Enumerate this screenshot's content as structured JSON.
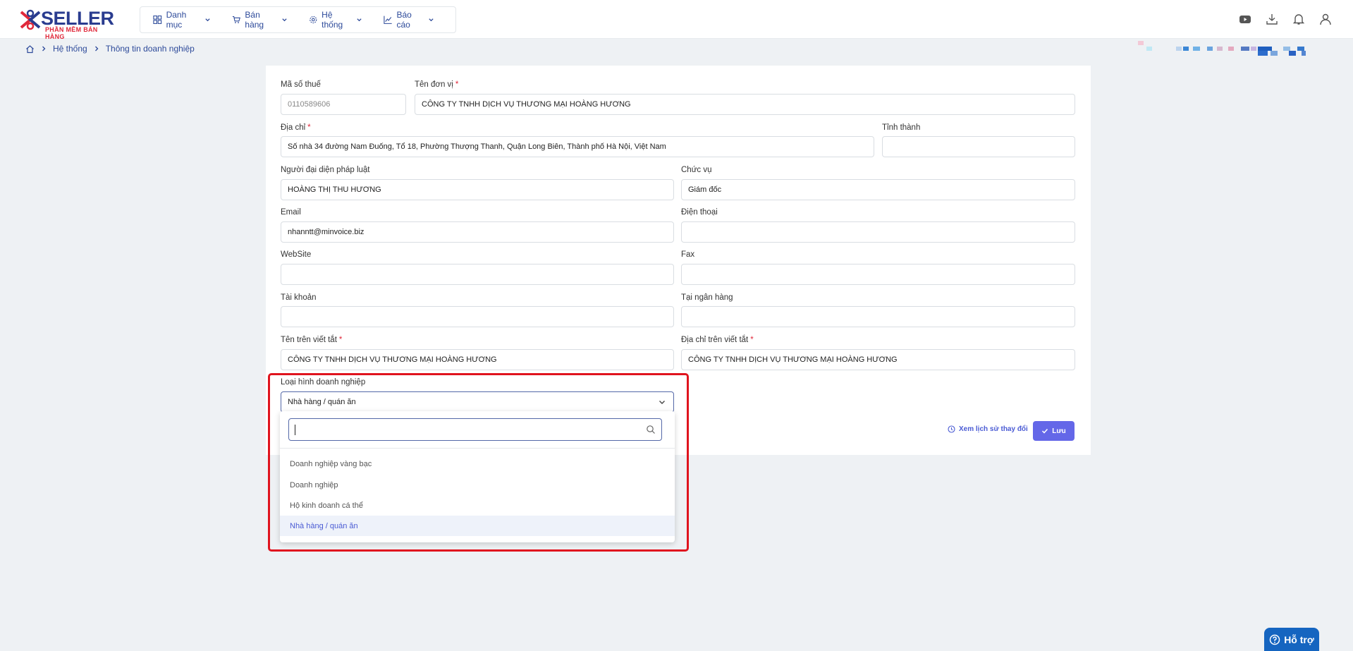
{
  "header": {
    "logo_brand": "SELLER",
    "logo_tagline": "PHẦN MỀM BÁN HÀNG",
    "menu": [
      {
        "label": "Danh mục",
        "icon": "grid-icon"
      },
      {
        "label": "Bán hàng",
        "icon": "cart-icon"
      },
      {
        "label": "Hệ thống",
        "icon": "gear-icon"
      },
      {
        "label": "Báo cáo",
        "icon": "chart-icon"
      }
    ],
    "right_icons": [
      "youtube-icon",
      "download-icon",
      "bell-icon",
      "user-icon"
    ]
  },
  "breadcrumb": {
    "home_icon": "home-icon",
    "items": [
      "Hệ thống",
      "Thông tin doanh nghiệp"
    ]
  },
  "form": {
    "tax_code": {
      "label": "Mã số thuế",
      "value": "0110589606"
    },
    "unit_name": {
      "label": "Tên đơn vị",
      "value": "CÔNG TY TNHH DỊCH VỤ THƯƠNG MẠI HOÀNG HƯƠNG"
    },
    "address": {
      "label": "Địa chỉ",
      "value": "Số nhà 34 đường Nam Đuống, Tổ 18, Phường Thượng Thanh, Quận Long Biên, Thành phố Hà Nội, Việt Nam"
    },
    "province": {
      "label": "Tỉnh thành",
      "value": ""
    },
    "legal_rep": {
      "label": "Người đại diện pháp luật",
      "value": "HOÀNG THỊ THU HƯƠNG"
    },
    "position": {
      "label": "Chức vụ",
      "value": "Giám đốc"
    },
    "email": {
      "label": "Email",
      "value": "nhanntt@minvoice.biz"
    },
    "phone": {
      "label": "Điện thoại",
      "value": ""
    },
    "website": {
      "label": "WebSite",
      "value": ""
    },
    "fax": {
      "label": "Fax",
      "value": ""
    },
    "account": {
      "label": "Tài khoản",
      "value": ""
    },
    "bank": {
      "label": "Tại ngân hàng",
      "value": ""
    },
    "short_name": {
      "label": "Tên trên viết tắt",
      "value": "CÔNG TY TNHH DỊCH VỤ THƯƠNG MẠI HOÀNG HƯƠNG"
    },
    "short_address": {
      "label": "Địa chỉ trên viết tắt",
      "value": "CÔNG TY TNHH DỊCH VỤ THƯƠNG MẠI HOÀNG HƯƠNG"
    },
    "business_type": {
      "label": "Loại hình doanh nghiệp",
      "value": "Nhà hàng / quán ăn",
      "search_value": "",
      "options": [
        "Doanh nghiệp vàng bạc",
        "Doanh nghiệp",
        "Hộ kinh doanh cá thể",
        "Nhà hàng / quán ăn"
      ],
      "selected_index": 3
    },
    "required_marker": "*"
  },
  "actions": {
    "history_label": "Xem lịch sử thay đổi",
    "save_label": "Lưu"
  },
  "help": {
    "label": "Hỗ trợ"
  },
  "colors": {
    "accent": "#6467e8",
    "highlight": "#e0141e",
    "brand": "#2a3c8f",
    "help": "#1565c0"
  }
}
